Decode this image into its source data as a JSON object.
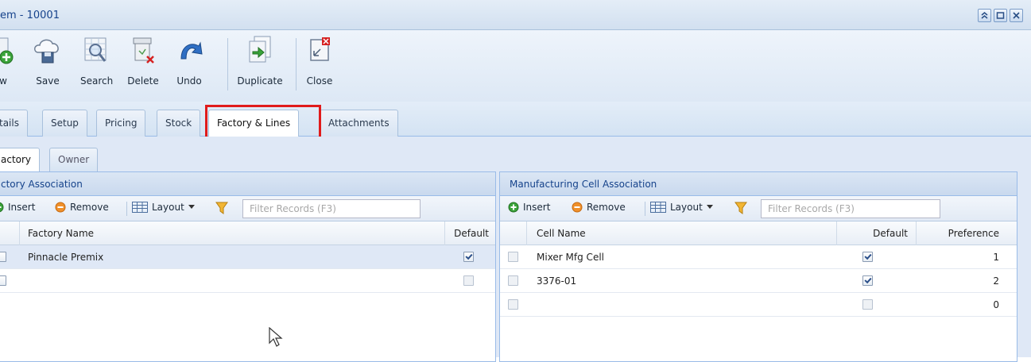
{
  "window": {
    "title": "em - 10001"
  },
  "toolbar": {
    "buttons": [
      {
        "label": "w",
        "icon": "new-icon"
      },
      {
        "label": "Save",
        "icon": "save-icon"
      },
      {
        "label": "Search",
        "icon": "search-icon"
      },
      {
        "label": "Delete",
        "icon": "delete-icon"
      },
      {
        "label": "Undo",
        "icon": "undo-icon"
      },
      {
        "label": "Duplicate",
        "icon": "duplicate-icon"
      },
      {
        "label": "Close",
        "icon": "close-icon"
      }
    ]
  },
  "tabs": [
    {
      "label": "tails"
    },
    {
      "label": "Setup"
    },
    {
      "label": "Pricing"
    },
    {
      "label": "Stock"
    },
    {
      "label": "Factory & Lines",
      "active": true
    },
    {
      "label": "Attachments"
    }
  ],
  "subtabs": [
    {
      "label": "actory",
      "active": true
    },
    {
      "label": "Owner"
    }
  ],
  "factory_panel": {
    "title": "ctory Association",
    "toolbar": {
      "insert": "Insert",
      "remove": "Remove",
      "layout": "Layout",
      "filter_placeholder": "Filter Records (F3)"
    },
    "columns": {
      "name": "Factory Name",
      "default": "Default"
    },
    "rows": [
      {
        "name": "Pinnacle Premix",
        "default": true
      },
      {
        "name": "",
        "default": false
      }
    ]
  },
  "cell_panel": {
    "title": "Manufacturing Cell Association",
    "toolbar": {
      "insert": "Insert",
      "remove": "Remove",
      "layout": "Layout",
      "filter_placeholder": "Filter Records (F3)"
    },
    "columns": {
      "name": "Cell Name",
      "default": "Default",
      "preference": "Preference"
    },
    "rows": [
      {
        "name": "Mixer Mfg Cell",
        "default": true,
        "preference": "1"
      },
      {
        "name": "3376-01",
        "default": true,
        "preference": "2"
      },
      {
        "name": "",
        "default": false,
        "preference": "0"
      }
    ]
  },
  "colors": {
    "highlight": "#e01b1b",
    "header_text": "#15428b",
    "panel_border": "#99bbe8"
  }
}
